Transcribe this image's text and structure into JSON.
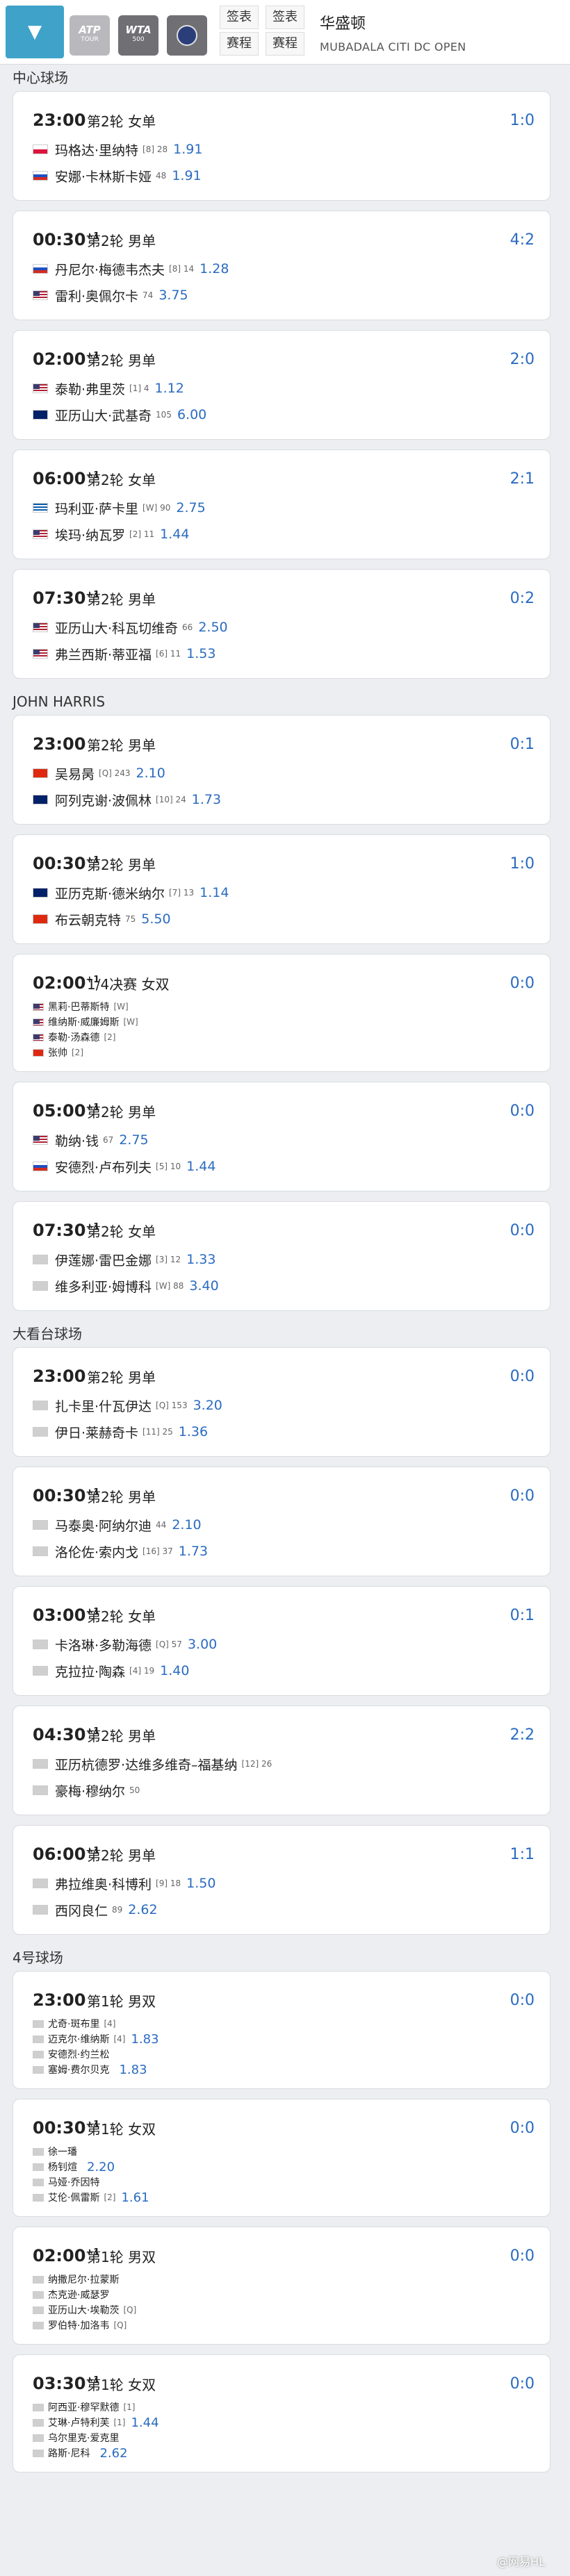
{
  "header": {
    "dropdown_icon": "▼",
    "logos": [
      {
        "text": "ATP",
        "sub": "TOUR"
      },
      {
        "text": "WTA",
        "sub": "500"
      },
      {
        "text": "",
        "sub": ""
      }
    ],
    "tabs": [
      [
        "签表",
        "赛程"
      ],
      [
        "签表",
        "赛程"
      ]
    ],
    "title": "华盛顿",
    "subtitle": "MUBADALA CITI DC OPEN"
  },
  "colors": {
    "accent": "#3fa3c9",
    "score": "#2a6bc1"
  },
  "sections": [
    {
      "name": "中心球场",
      "matches": [
        {
          "time": "23:00",
          "sup": "",
          "round": "第2轮 女单",
          "score": "1:0",
          "type": "single",
          "players": [
            {
              "flag": "pl",
              "name": "玛格达·里纳特",
              "tag": "[8] 28",
              "odds": "1.91"
            },
            {
              "flag": "ru",
              "name": "安娜·卡林斯卡娅",
              "tag": "48",
              "odds": "1.91"
            }
          ]
        },
        {
          "time": "00:30",
          "sup": "+1",
          "round": "第2轮 男单",
          "score": "4:2",
          "type": "single",
          "players": [
            {
              "flag": "ru",
              "name": "丹尼尔·梅德韦杰夫",
              "tag": "[8] 14",
              "odds": "1.28"
            },
            {
              "flag": "us",
              "name": "雷利·奥佩尔卡",
              "tag": "74",
              "odds": "3.75"
            }
          ]
        },
        {
          "time": "02:00",
          "sup": "+1",
          "round": "第2轮 男单",
          "score": "2:0",
          "type": "single",
          "players": [
            {
              "flag": "us",
              "name": "泰勒·弗里茨",
              "tag": "[1] 4",
              "odds": "1.12"
            },
            {
              "flag": "au",
              "name": "亚历山大·武基奇",
              "tag": "105",
              "odds": "6.00"
            }
          ]
        },
        {
          "time": "06:00",
          "sup": "+1",
          "round": "第2轮 女单",
          "score": "2:1",
          "type": "single",
          "players": [
            {
              "flag": "gr",
              "name": "玛利亚·萨卡里",
              "tag": "[W] 90",
              "odds": "2.75"
            },
            {
              "flag": "us",
              "name": "埃玛·纳瓦罗",
              "tag": "[2] 11",
              "odds": "1.44"
            }
          ]
        },
        {
          "time": "07:30",
          "sup": "+1",
          "round": "第2轮 男单",
          "score": "0:2",
          "type": "single",
          "players": [
            {
              "flag": "us",
              "name": "亚历山大·科瓦切维奇",
              "tag": "66",
              "odds": "2.50"
            },
            {
              "flag": "us",
              "name": "弗兰西斯·蒂亚福",
              "tag": "[6] 11",
              "odds": "1.53"
            }
          ]
        }
      ]
    },
    {
      "name": "JOHN HARRIS",
      "matches": [
        {
          "time": "23:00",
          "sup": "",
          "round": "第2轮 男单",
          "score": "0:1",
          "type": "single",
          "players": [
            {
              "flag": "cn",
              "name": "吴易昺",
              "tag": "[Q] 243",
              "odds": "2.10"
            },
            {
              "flag": "au",
              "name": "阿列克谢·波佩林",
              "tag": "[10] 24",
              "odds": "1.73"
            }
          ]
        },
        {
          "time": "00:30",
          "sup": "+1",
          "round": "第2轮 男单",
          "score": "1:0",
          "type": "single",
          "players": [
            {
              "flag": "au",
              "name": "亚历克斯·德米纳尔",
              "tag": "[7] 13",
              "odds": "1.14"
            },
            {
              "flag": "cn",
              "name": "布云朝克特",
              "tag": "75",
              "odds": "5.50"
            }
          ]
        },
        {
          "time": "02:00",
          "sup": "+1",
          "round": "1/4决赛 女双",
          "score": "0:0",
          "type": "double",
          "players": [
            {
              "flag": "us",
              "name": "黑莉·巴蒂斯特",
              "tag": "[W]",
              "odds": ""
            },
            {
              "flag": "us",
              "name": "维纳斯·威廉姆斯",
              "tag": "[W]",
              "odds": ""
            },
            {
              "flag": "us",
              "name": "泰勒·汤森德",
              "tag": "[2]",
              "odds": ""
            },
            {
              "flag": "cn",
              "name": "张帅",
              "tag": "[2]",
              "odds": ""
            }
          ]
        },
        {
          "time": "05:00",
          "sup": "+1",
          "round": "第2轮 男单",
          "score": "0:0",
          "type": "single",
          "players": [
            {
              "flag": "us",
              "name": "勒纳·钱",
              "tag": "67",
              "odds": "2.75"
            },
            {
              "flag": "ru",
              "name": "安德烈·卢布列夫",
              "tag": "[5] 10",
              "odds": "1.44"
            }
          ]
        },
        {
          "time": "07:30",
          "sup": "+1",
          "round": "第2轮 女单",
          "score": "0:0",
          "type": "single",
          "players": [
            {
              "flag": "gy",
              "name": "伊莲娜·雷巴金娜",
              "tag": "[3] 12",
              "odds": "1.33"
            },
            {
              "flag": "gy",
              "name": "维多利亚·姆博科",
              "tag": "[W] 88",
              "odds": "3.40"
            }
          ]
        }
      ]
    },
    {
      "name": "大看台球场",
      "matches": [
        {
          "time": "23:00",
          "sup": "",
          "round": "第2轮 男单",
          "score": "0:0",
          "type": "single",
          "players": [
            {
              "flag": "gy",
              "name": "扎卡里·什瓦伊达",
              "tag": "[Q] 153",
              "odds": "3.20"
            },
            {
              "flag": "gy",
              "name": "伊日·莱赫奇卡",
              "tag": "[11] 25",
              "odds": "1.36"
            }
          ]
        },
        {
          "time": "00:30",
          "sup": "+1",
          "round": "第2轮 男单",
          "score": "0:0",
          "type": "single",
          "players": [
            {
              "flag": "gy",
              "name": "马泰奥·阿纳尔迪",
              "tag": "44",
              "odds": "2.10"
            },
            {
              "flag": "gy",
              "name": "洛伦佐·索内戈",
              "tag": "[16] 37",
              "odds": "1.73"
            }
          ]
        },
        {
          "time": "03:00",
          "sup": "+1",
          "round": "第2轮 女单",
          "score": "0:1",
          "type": "single",
          "players": [
            {
              "flag": "gy",
              "name": "卡洛琳·多勒海德",
              "tag": "[Q] 57",
              "odds": "3.00"
            },
            {
              "flag": "gy",
              "name": "克拉拉·陶森",
              "tag": "[4] 19",
              "odds": "1.40"
            }
          ]
        },
        {
          "time": "04:30",
          "sup": "+1",
          "round": "第2轮 男单",
          "score": "2:2",
          "type": "single",
          "players": [
            {
              "flag": "gy",
              "name": "亚历杭德罗·达维多维奇–福基纳",
              "tag": "[12] 26",
              "odds": ""
            },
            {
              "flag": "gy",
              "name": "豪梅·穆纳尔",
              "tag": "50",
              "odds": ""
            }
          ]
        },
        {
          "time": "06:00",
          "sup": "+1",
          "round": "第2轮 男单",
          "score": "1:1",
          "type": "single",
          "players": [
            {
              "flag": "gy",
              "name": "弗拉维奥·科博利",
              "tag": "[9] 18",
              "odds": "1.50"
            },
            {
              "flag": "gy",
              "name": "西冈良仁",
              "tag": "89",
              "odds": "2.62"
            }
          ]
        }
      ]
    },
    {
      "name": "4号球场",
      "matches": [
        {
          "time": "23:00",
          "sup": "",
          "round": "第1轮 男双",
          "score": "0:0",
          "type": "double",
          "players": [
            {
              "flag": "gy",
              "name": "尤奇·斑布里",
              "tag": "[4]",
              "odds": ""
            },
            {
              "flag": "gy",
              "name": "迈克尔·维纳斯",
              "tag": "[4]",
              "odds": "1.83"
            },
            {
              "flag": "gy",
              "name": "安德烈·约兰松",
              "tag": "",
              "odds": ""
            },
            {
              "flag": "gy",
              "name": "塞姆·费尔贝克",
              "tag": "",
              "odds": "1.83"
            }
          ]
        },
        {
          "time": "00:30",
          "sup": "+1",
          "round": "第1轮 女双",
          "score": "0:0",
          "type": "double",
          "players": [
            {
              "flag": "gy",
              "name": "徐一璠",
              "tag": "",
              "odds": ""
            },
            {
              "flag": "gy",
              "name": "杨钊煊",
              "tag": "",
              "odds": "2.20"
            },
            {
              "flag": "gy",
              "name": "马娅·乔因特",
              "tag": "",
              "odds": ""
            },
            {
              "flag": "gy",
              "name": "艾伦·佩雷斯",
              "tag": "[2]",
              "odds": "1.61"
            }
          ]
        },
        {
          "time": "02:00",
          "sup": "+1",
          "round": "第1轮 男双",
          "score": "0:0",
          "type": "double",
          "players": [
            {
              "flag": "gy",
              "name": "纳撒尼尔·拉蒙斯",
              "tag": "",
              "odds": ""
            },
            {
              "flag": "gy",
              "name": "杰克逊·威瑟罗",
              "tag": "",
              "odds": ""
            },
            {
              "flag": "gy",
              "name": "亚历山大·埃勒茨",
              "tag": "[Q]",
              "odds": ""
            },
            {
              "flag": "gy",
              "name": "罗伯特·加洛韦",
              "tag": "[Q]",
              "odds": ""
            }
          ]
        },
        {
          "time": "03:30",
          "sup": "+1",
          "round": "第1轮 女双",
          "score": "0:0",
          "type": "double",
          "players": [
            {
              "flag": "gy",
              "name": "阿西亚·穆罕默德",
              "tag": "[1]",
              "odds": ""
            },
            {
              "flag": "gy",
              "name": "艾琳·卢特利芙",
              "tag": "[1]",
              "odds": "1.44"
            },
            {
              "flag": "gy",
              "name": "乌尔里克·爱克里",
              "tag": "",
              "odds": ""
            },
            {
              "flag": "gy",
              "name": "路斯·尼科",
              "tag": "",
              "odds": "2.62"
            }
          ]
        }
      ]
    }
  ],
  "watermark": "@网易HL"
}
